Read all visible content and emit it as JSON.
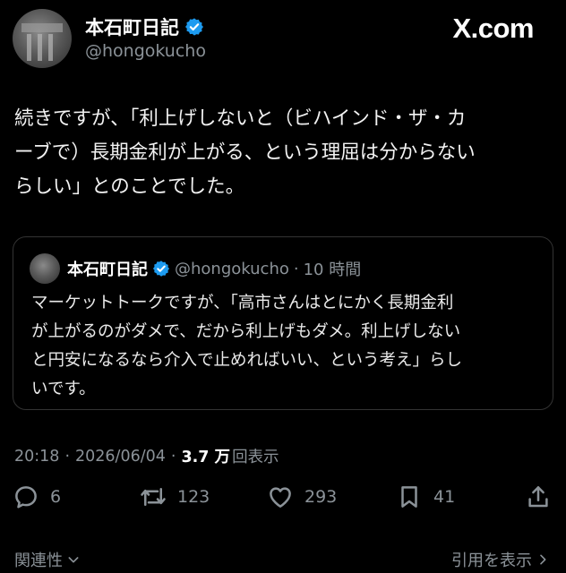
{
  "brand": {
    "label": "X.com"
  },
  "author": {
    "name": "本石町日記",
    "handle": "@hongokucho"
  },
  "tweet": {
    "lines": [
      "続きですが、「利上げしないと（ビハインド・ザ・カ",
      "ーブで）長期金利が上がる、という理屈は分からない",
      "らしい」とのことでした。"
    ]
  },
  "quote": {
    "name": "本石町日記",
    "handle": "@hongokucho",
    "separator": "·",
    "time": "10 時間",
    "lines": [
      "マーケットトークですが、「高市さんはとにかく長期金利",
      "が上がるのがダメで、だから利上げもダメ。利上げしない",
      "と円安になるなら介入で止めればいい、という考え」らし",
      "いです。"
    ]
  },
  "meta": {
    "time": "20:18",
    "sep1": "·",
    "date": "2026/06/04",
    "sep2": "·",
    "views_count": "3.7 万",
    "views_label": "回表示"
  },
  "actions": {
    "replies": "6",
    "reposts": "123",
    "likes": "293",
    "bookmarks": "41"
  },
  "footer": {
    "related": "関連性",
    "view_quotes": "引用を表示"
  },
  "colors": {
    "background": "#000000",
    "verified": "#1d9bf0",
    "muted_text": "#8b9298"
  }
}
